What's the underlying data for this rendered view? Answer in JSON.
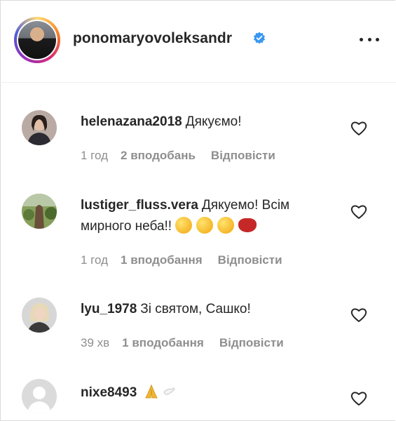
{
  "post": {
    "author": "ponomaryovoleksandr",
    "verified": true
  },
  "comments": [
    {
      "username": "helenazana2018",
      "text": "Дякуємо!",
      "time": "1 год",
      "likes": "2 вподобань",
      "reply": "Відповісти",
      "avatar_icon": "profile-photo-woman-dark-hair"
    },
    {
      "username": "lustiger_fluss.vera",
      "text": "Дякуемо! Всім мирного неба!!",
      "emojis": [
        "smiling-face-icon",
        "smiling-face-icon",
        "smiling-face-icon",
        "red-heart-icon"
      ],
      "time": "1 год",
      "likes": "1 вподобання",
      "reply": "Відповісти",
      "avatar_icon": "profile-photo-landscape"
    },
    {
      "username": "lyu_1978",
      "text": "Зі святом, Сашко!",
      "time": "39 хв",
      "likes": "1 вподобання",
      "reply": "Відповісти",
      "avatar_icon": "profile-photo-woman-blonde"
    },
    {
      "username": "nixe8493",
      "emojis": [
        "folded-hands-icon",
        "dove-icon"
      ],
      "avatar_icon": "default-avatar-icon"
    }
  ],
  "colors": {
    "text": "#262626",
    "muted": "#8e8e8e",
    "verified": "#3897f0"
  }
}
